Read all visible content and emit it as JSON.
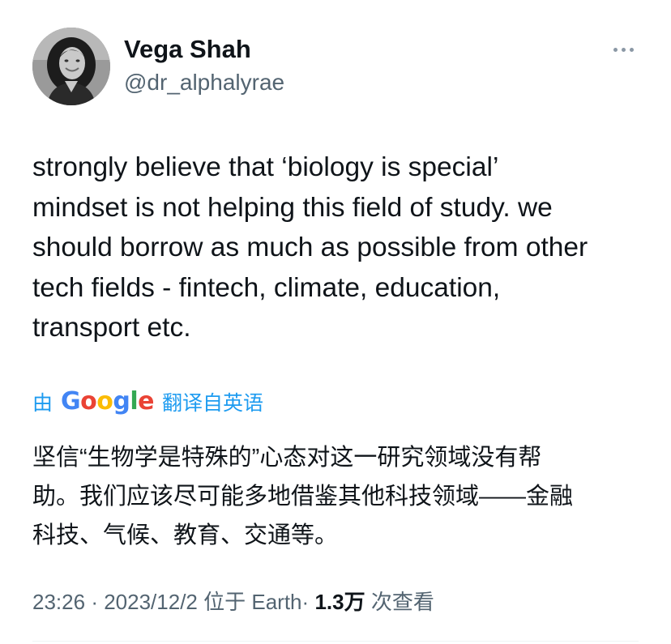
{
  "author": {
    "display_name": "Vega Shah",
    "handle": "@dr_alphalyrae",
    "avatar_icon": "profile-photo"
  },
  "more_icon": "ellipsis-icon",
  "tweet": {
    "lines": [
      "strongly believe that ‘biology is special’",
      "mindset is not helping this field of study. we",
      "should borrow as much as possible from other",
      "tech fields - fintech, climate, education,",
      "transport etc."
    ]
  },
  "translation": {
    "by_label": "由",
    "provider": "Google",
    "from_label": "翻译自英语",
    "link_color": "#1d9bf0",
    "lines": [
      "坚信“生物学是特殊的”心态对这一研究领域没有帮",
      "助。我们应该尽可能多地借鉴其他科技领域——金融",
      "科技、气候、教育、交通等。"
    ]
  },
  "meta": {
    "time": "23:26",
    "separator": "·",
    "date": "2023/12/2",
    "location_prefix": "位于",
    "location": "Earth",
    "views_count": "1.3万",
    "views_label": "次查看"
  },
  "colors": {
    "text": "#0f1419",
    "secondary": "#536471",
    "google_blue": "#4285F4",
    "google_red": "#EA4335",
    "google_yellow": "#FBBC05",
    "google_green": "#34A853"
  }
}
